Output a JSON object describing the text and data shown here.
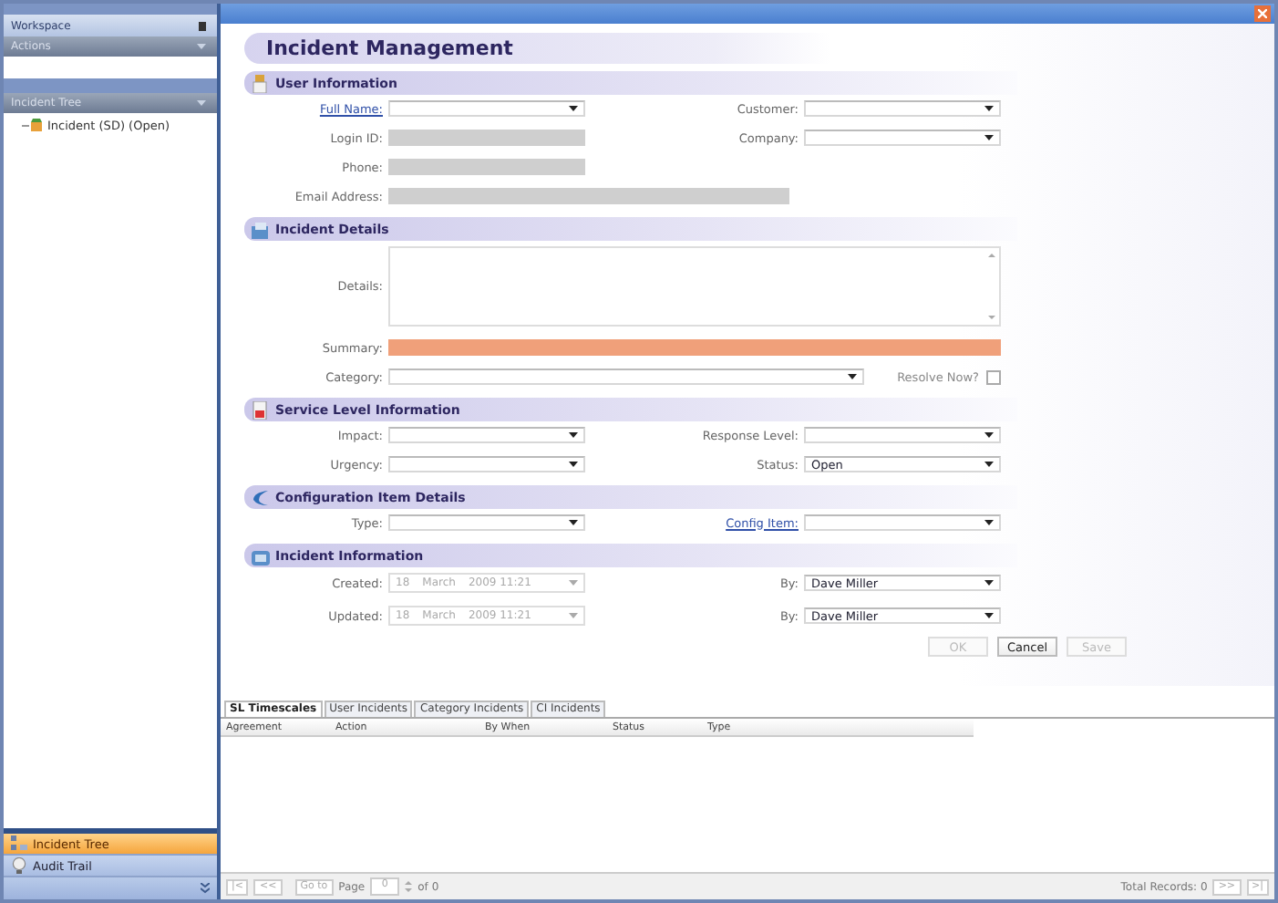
{
  "sidebar": {
    "title": "Workspace",
    "panels": [
      {
        "title": "Actions"
      },
      {
        "title": "Incident Tree",
        "items": [
          {
            "label": "Incident (SD) (Open)"
          }
        ]
      }
    ],
    "nav": [
      {
        "label": "Incident Tree",
        "selected": true
      },
      {
        "label": "Audit Trail",
        "selected": false
      }
    ]
  },
  "form": {
    "title": "Incident Management",
    "sections": [
      {
        "title": "User Information",
        "rows": [
          [
            {
              "label": "Full Name:",
              "link": true,
              "kind": "dropdown"
            },
            {
              "label": "Customer:",
              "link": false,
              "kind": "dropdown"
            }
          ],
          [
            {
              "label": "Login ID:",
              "link": false,
              "kind": "readonly"
            },
            {
              "label": "Company:",
              "link": false,
              "kind": "dropdown"
            }
          ],
          [
            {
              "label": "Phone:",
              "link": false,
              "kind": "readonly"
            }
          ],
          [
            {
              "label": "Email Address:",
              "link": false,
              "kind": "readonly-wide"
            }
          ]
        ]
      },
      {
        "title": "Incident Details",
        "rows": [
          [
            {
              "label": "Details:",
              "link": false,
              "kind": "textarea"
            }
          ],
          [
            {
              "label": "Summary:",
              "link": false,
              "kind": "required"
            }
          ],
          [
            {
              "label": "Category:",
              "link": false,
              "kind": "dropdown-wide",
              "check_label": "Resolve Now?",
              "checked": false
            }
          ]
        ]
      },
      {
        "title": "Service Level Information",
        "rows": [
          [
            {
              "label": "Impact:",
              "link": false,
              "kind": "dropdown"
            },
            {
              "label": "Response Level:",
              "link": false,
              "kind": "dropdown"
            }
          ],
          [
            {
              "label": "Urgency:",
              "link": false,
              "kind": "dropdown"
            },
            {
              "label": "Status:",
              "link": false,
              "kind": "dropdown",
              "value": "Open"
            }
          ]
        ]
      },
      {
        "title": "Configuration Item Details",
        "rows": [
          [
            {
              "label": "Type:",
              "link": false,
              "kind": "dropdown"
            },
            {
              "label": "Config Item:",
              "link": true,
              "kind": "dropdown"
            }
          ]
        ]
      },
      {
        "title": "Incident Information",
        "rows": [
          [
            {
              "label": "Created:",
              "link": false,
              "kind": "date",
              "parts": [
                "18",
                "March",
                "2009 11:21"
              ]
            },
            {
              "label": "By:",
              "link": false,
              "kind": "dropdown",
              "value": "Dave Miller"
            }
          ],
          [
            {
              "label": "Updated:",
              "link": false,
              "kind": "date",
              "parts": [
                "18",
                "March",
                "2009 11:21"
              ]
            },
            {
              "label": "By:",
              "link": false,
              "kind": "dropdown",
              "value": "Dave Miller"
            }
          ]
        ]
      }
    ],
    "buttons": [
      {
        "label": "OK",
        "disabled": true
      },
      {
        "label": "Cancel",
        "disabled": false
      },
      {
        "label": "Save",
        "disabled": true
      }
    ]
  },
  "tabs": [
    {
      "label": "SL Timescales",
      "selected": true
    },
    {
      "label": "User Incidents",
      "selected": false
    },
    {
      "label": "Category Incidents",
      "selected": false
    },
    {
      "label": "CI Incidents",
      "selected": false
    }
  ],
  "table": {
    "columns": [
      "Agreement",
      "Action",
      "By When",
      "Status",
      "Type"
    ]
  },
  "pager": {
    "first": "|<",
    "prev": "<<",
    "goto": "Go to",
    "page_label": "Page",
    "page": "0",
    "of": "of 0",
    "total": "Total Records: 0",
    "next": ">>",
    "last": ">|"
  }
}
